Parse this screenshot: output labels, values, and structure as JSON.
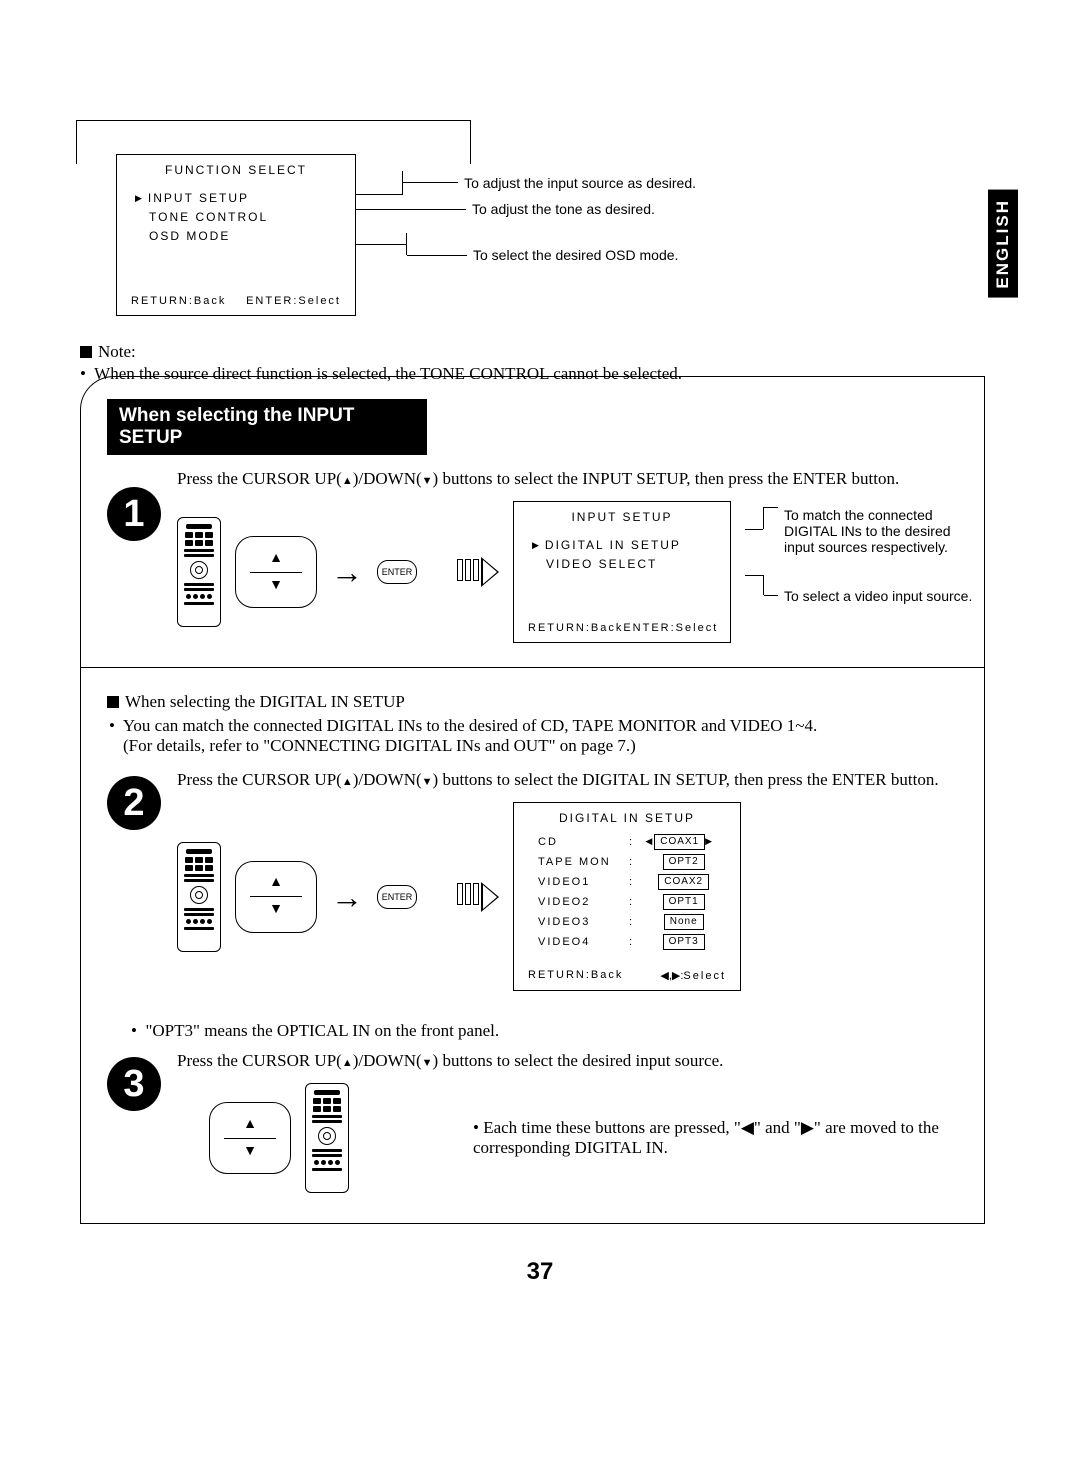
{
  "language_tab": "ENGLISH",
  "function_select_osd": {
    "title": "FUNCTION SELECT",
    "items": [
      "INPUT SETUP",
      "TONE CONTROL",
      "OSD MODE"
    ],
    "footer_left": "RETURN:Back",
    "footer_right": "ENTER:Select"
  },
  "function_select_labels": {
    "input": "To adjust the input source as desired.",
    "tone": "To adjust the tone as desired.",
    "osd": "To select the desired OSD mode."
  },
  "note_label": "Note:",
  "note_text": "When the source direct function is selected, the TONE CONTROL cannot be selected.",
  "section_header": "When selecting the INPUT SETUP",
  "step1": {
    "num": "1",
    "text_a": "Press the CURSOR UP(",
    "text_b": ")/DOWN(",
    "text_c": ") buttons to select the INPUT SETUP, then press the ENTER button.",
    "enter_label": "ENTER"
  },
  "input_setup_osd": {
    "title": "INPUT SETUP",
    "items": [
      "DIGITAL IN SETUP",
      "VIDEO SELECT"
    ],
    "footer_left": "RETURN:Back",
    "footer_right": "ENTER:Select"
  },
  "input_setup_labels": {
    "digital": "To match the connected DIGITAL INs to the desired input sources respectively.",
    "video": "To select a video input source."
  },
  "digital_in_header": "When selecting the DIGITAL IN SETUP",
  "digital_in_bullets": [
    "You can match the connected DIGITAL INs to the desired of CD, TAPE MONITOR and VIDEO 1~4.",
    "(For details, refer to \"CONNECTING DIGITAL INs and OUT\" on page 7.)"
  ],
  "step2": {
    "num": "2",
    "text_a": "Press the CURSOR UP(",
    "text_b": ")/DOWN(",
    "text_c": ") buttons to select the DIGITAL IN SETUP, then press the ENTER button.",
    "enter_label": "ENTER"
  },
  "digital_in_osd": {
    "title": "DIGITAL IN SETUP",
    "rows": [
      {
        "label": "CD",
        "value": "COAX1",
        "selected": true
      },
      {
        "label": "TAPE MON",
        "value": "OPT2"
      },
      {
        "label": "VIDEO1",
        "value": "COAX2"
      },
      {
        "label": "VIDEO2",
        "value": "OPT1"
      },
      {
        "label": "VIDEO3",
        "value": "None"
      },
      {
        "label": "VIDEO4",
        "value": "OPT3"
      }
    ],
    "footer_left": "RETURN:Back",
    "footer_right_prefix": "◀,▶:",
    "footer_right": "Select"
  },
  "opt3_note": "\"OPT3\" means the OPTICAL IN on the front panel.",
  "step3": {
    "num": "3",
    "text_a": "Press the CURSOR UP(",
    "text_b": ")/DOWN(",
    "text_c": ") buttons to select the desired input source."
  },
  "step3_each_a": "Each time these buttons are pressed, \"",
  "step3_each_b": "\" and \"",
  "step3_each_c": "\" are moved to the corresponding DIGITAL IN.",
  "page_number": "37"
}
